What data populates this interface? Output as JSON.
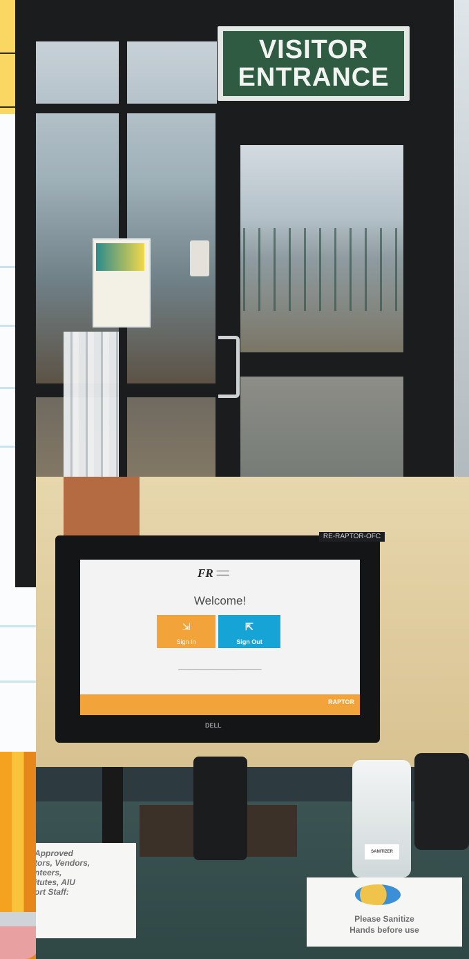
{
  "entrance_photo": {
    "sign": {
      "line1": "VISITOR",
      "line2": "ENTRANCE"
    }
  },
  "kiosk_photo": {
    "device_tag": "RE-RAPTOR-OFC",
    "screen": {
      "logo_mark": "FR",
      "welcome_text": "Welcome!",
      "sign_in_label": "Sign In",
      "sign_out_label": "Sign Out",
      "footer_brand": "RAPTOR"
    },
    "monitor_brand": "DELL",
    "sanitizer_label": "SANITIZER",
    "note_left": "Approved\ntors, Vendors,\nnteers,\nitutes, AIU\nort Staff:",
    "note_right": "Please Sanitize\nHands before use"
  },
  "colors": {
    "sign_green": "#2e5b42",
    "sign_in_orange": "#f2a33a",
    "sign_out_blue": "#16a3d6",
    "notebook_yellow": "#f9d762",
    "accent_blue": "#3d63d8"
  },
  "icons": {
    "sign_in": "door-enter-icon",
    "sign_out": "door-exit-icon"
  }
}
